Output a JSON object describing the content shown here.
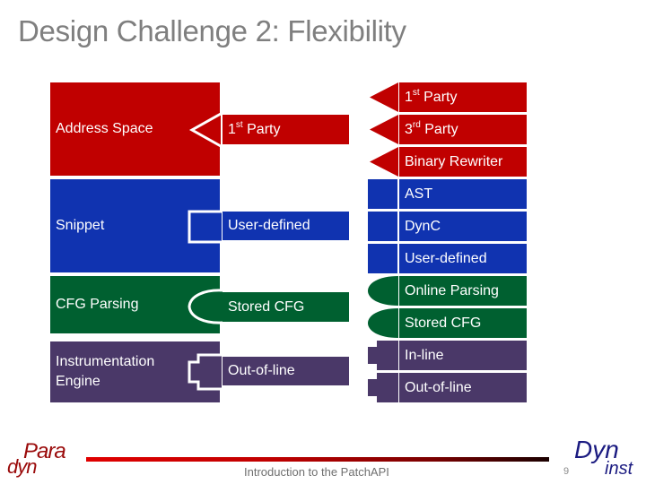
{
  "title": "Design Challenge 2: Flexibility",
  "colors": {
    "address_space": "#c00000",
    "snippet": "#1033b0",
    "cfg_parsing": "#006030",
    "instrumentation": "#4a3868",
    "title_text": "#7f7f7f"
  },
  "components": [
    {
      "name": "Address Space",
      "connector": "triangle",
      "current": {
        "base": "1",
        "sup": "st",
        "rest": " Party"
      },
      "options": [
        {
          "base": "1",
          "sup": "st",
          "rest": " Party"
        },
        {
          "base": "3",
          "sup": "rd",
          "rest": " Party"
        },
        {
          "base": "Binary Rewriter",
          "sup": "",
          "rest": ""
        }
      ]
    },
    {
      "name": "Snippet",
      "connector": "square",
      "current": {
        "base": "User-defined"
      },
      "options": [
        {
          "base": "AST"
        },
        {
          "base": "DynC"
        },
        {
          "base": "User-defined"
        }
      ]
    },
    {
      "name": "CFG Parsing",
      "connector": "ellipse",
      "current": {
        "base": "Stored CFG"
      },
      "options": [
        {
          "base": "Online Parsing"
        },
        {
          "base": "Stored CFG"
        }
      ]
    },
    {
      "name_line1": "Instrumentation",
      "name_line2": "Engine",
      "connector": "puzzle",
      "current": {
        "base": "Out-of-line"
      },
      "options": [
        {
          "base": "In-line"
        },
        {
          "base": "Out-of-line"
        }
      ]
    }
  ],
  "footer": {
    "text": "Introduction to the PatchAPI",
    "page_number": "9",
    "logo_left_top": "Para",
    "logo_left_bottom": "dyn",
    "logo_right_top": "Dyn",
    "logo_right_bottom": "inst"
  }
}
